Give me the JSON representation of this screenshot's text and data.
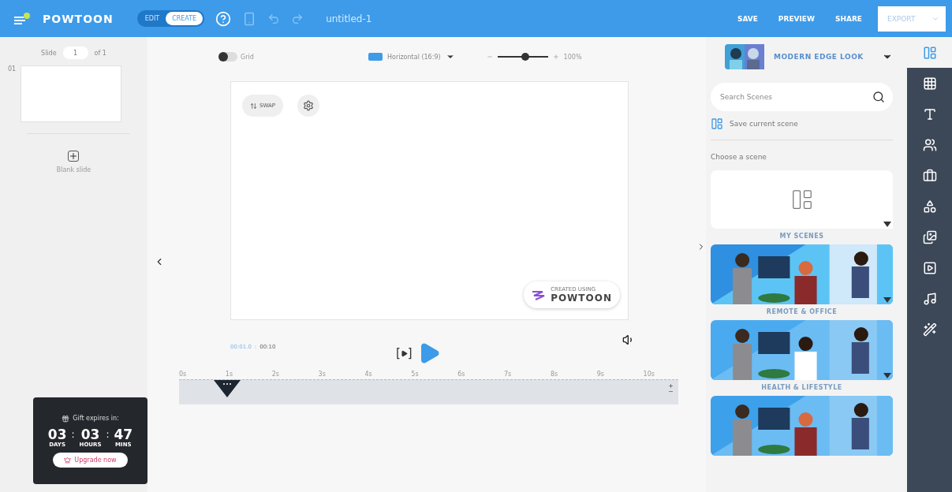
{
  "topbar": {
    "logo": "POWTOON",
    "modes": [
      {
        "label": "EDIT",
        "selected": false
      },
      {
        "label": "CREATE",
        "selected": true
      }
    ],
    "title": "untitled-1",
    "actions": [
      "SAVE",
      "PREVIEW",
      "SHARE"
    ],
    "export": "EXPORT"
  },
  "slides_panel": {
    "slide_label": "Slide",
    "slide_value": "1",
    "slide_total": "of 1",
    "slides": [
      {
        "number": "01",
        "selected": true
      }
    ],
    "blank_slide": "Blank slide"
  },
  "gift": {
    "title": "Gift expires in:",
    "separator": ":",
    "units": [
      {
        "value": "03",
        "label": "DAYS"
      },
      {
        "value": "03",
        "label": "HOURS"
      },
      {
        "value": "47",
        "label": "MINS"
      }
    ],
    "button": "Upgrade now"
  },
  "canvas_toolbar": {
    "grid": {
      "label": "Grid",
      "on": false
    },
    "aspect": "Horizontal (16:9)",
    "zoom": {
      "level": 0.55,
      "reading": "100%"
    }
  },
  "canvas": {
    "swap": "SWAP",
    "badge_small": "CREATED USING",
    "badge_big": "POWTOON"
  },
  "player": {
    "bracket_open": "[",
    "bracket_close": "]",
    "current": "00:01.0",
    "separator": ":",
    "total": "00:10"
  },
  "timeline": {
    "ticks": [
      "0s",
      "1s",
      "2s",
      "3s",
      "4s",
      "5s",
      "6s",
      "7s",
      "8s",
      "9s",
      "10s"
    ],
    "level": 0.1
  },
  "scenes_panel": {
    "look": "MODERN EDGE LOOK",
    "search": {
      "placeholder": "Search Scenes"
    },
    "save_scene": "Save current scene",
    "choose": "Choose a scene",
    "categories": [
      {
        "kind": "empty",
        "label": "MY SCENES"
      },
      {
        "kind": "picture",
        "label": "REMOTE & OFFICE"
      },
      {
        "kind": "picture",
        "label": "HEALTH & LIFESTYLE"
      },
      {
        "kind": "picture"
      }
    ]
  },
  "rail": [
    {
      "kind": "scenes",
      "selected": true
    },
    {
      "kind": "pattern",
      "selected": false
    },
    {
      "kind": "text",
      "selected": false
    },
    {
      "kind": "characters",
      "selected": false
    },
    {
      "kind": "props",
      "selected": false
    },
    {
      "kind": "shapes",
      "selected": false
    },
    {
      "kind": "media",
      "selected": false
    },
    {
      "kind": "video",
      "selected": false
    },
    {
      "kind": "music",
      "selected": false
    },
    {
      "kind": "magic",
      "selected": false
    }
  ]
}
